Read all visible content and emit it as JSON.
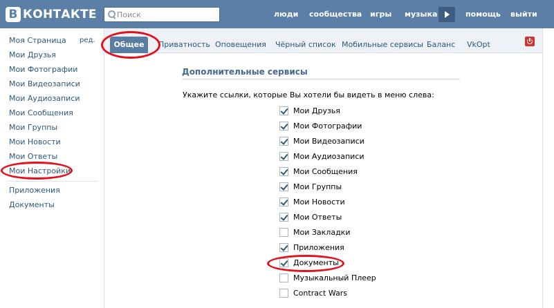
{
  "header": {
    "logo_mark": "В",
    "logo_text": "КОНТАКТЕ",
    "search_placeholder": "Поиск",
    "nav": [
      "люди",
      "сообщества",
      "игры",
      "музыка",
      "помощь",
      "выйти"
    ]
  },
  "sidebar": {
    "edit_label": "ред.",
    "items": [
      "Моя Страница",
      "Мои Друзья",
      "Мои Фотографии",
      "Мои Видеозаписи",
      "Мои Аудиозаписи",
      "Мои Сообщения",
      "Мои Группы",
      "Мои Новости",
      "Мои Ответы",
      "Мои Настройки"
    ],
    "extra_items": [
      "Приложения",
      "Документы"
    ]
  },
  "tabs": {
    "active": "Общее",
    "items": [
      "Приватность",
      "Оповещения",
      "Чёрный список",
      "Мобильные сервисы",
      "Баланс",
      "VkOpt"
    ]
  },
  "section": {
    "title": "Дополнительные сервисы",
    "hint": "Укажите ссылки, которые Вы хотели бы видеть в меню слева:"
  },
  "services": [
    {
      "label": "Мои Друзья",
      "checked": true
    },
    {
      "label": "Мои Фотографии",
      "checked": true
    },
    {
      "label": "Мои Видеозаписи",
      "checked": true
    },
    {
      "label": "Мои Аудиозаписи",
      "checked": true
    },
    {
      "label": "Мои Сообщения",
      "checked": true
    },
    {
      "label": "Мои Группы",
      "checked": true
    },
    {
      "label": "Мои Новости",
      "checked": true
    },
    {
      "label": "Мои Ответы",
      "checked": true
    },
    {
      "label": "Мои Закладки",
      "checked": false
    },
    {
      "label": "Приложения",
      "checked": true
    },
    {
      "label": "Документы",
      "checked": true
    },
    {
      "label": "Музыкальный Плеер",
      "checked": false
    },
    {
      "label": "Contract Wars",
      "checked": false
    }
  ],
  "colors": {
    "header": "#5b7fa6",
    "link": "#2b587a",
    "active_tab": "#597da3",
    "annotation": "#e4101c"
  }
}
